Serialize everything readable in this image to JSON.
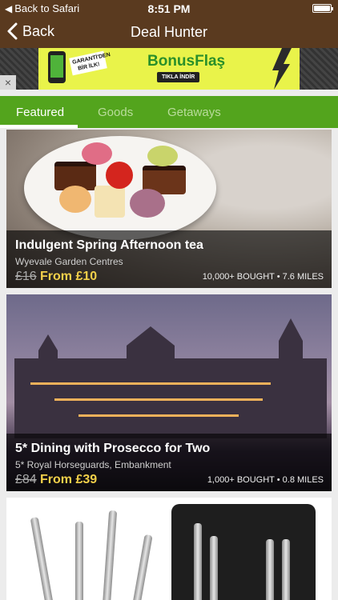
{
  "status_bar": {
    "back_label": "Back to Safari",
    "time": "8:51 PM",
    "battery_level": 1.0
  },
  "nav": {
    "back_label": "Back",
    "title": "Deal Hunter"
  },
  "ad": {
    "tag_text": "GARANTİ'DEN BİR İLK!",
    "brand": "BonusFlaş",
    "cta": "TIKLA İNDİR",
    "close_symbol": "×",
    "colors": {
      "background": "#e9f34a",
      "brand": "#2a8f2a"
    }
  },
  "tabs": [
    {
      "label": "Featured",
      "active": true
    },
    {
      "label": "Goods",
      "active": false
    },
    {
      "label": "Getaways",
      "active": false
    }
  ],
  "deals": [
    {
      "title": "Indulgent Spring Afternoon tea",
      "merchant": "Wyevale Garden Centres",
      "old_price": "£16",
      "new_price": "From £10",
      "stats": "10,000+ BOUGHT • 7.6 MILES"
    },
    {
      "title": "5* Dining with Prosecco for Two",
      "merchant": "5* Royal Horseguards, Embankment",
      "old_price": "£84",
      "new_price": "From £39",
      "stats": "1,000+ BOUGHT • 0.8 MILES"
    }
  ],
  "theme": {
    "header": "#5a3a1f",
    "tab_bar": "#53a41d",
    "price_accent": "#f2d04a"
  }
}
